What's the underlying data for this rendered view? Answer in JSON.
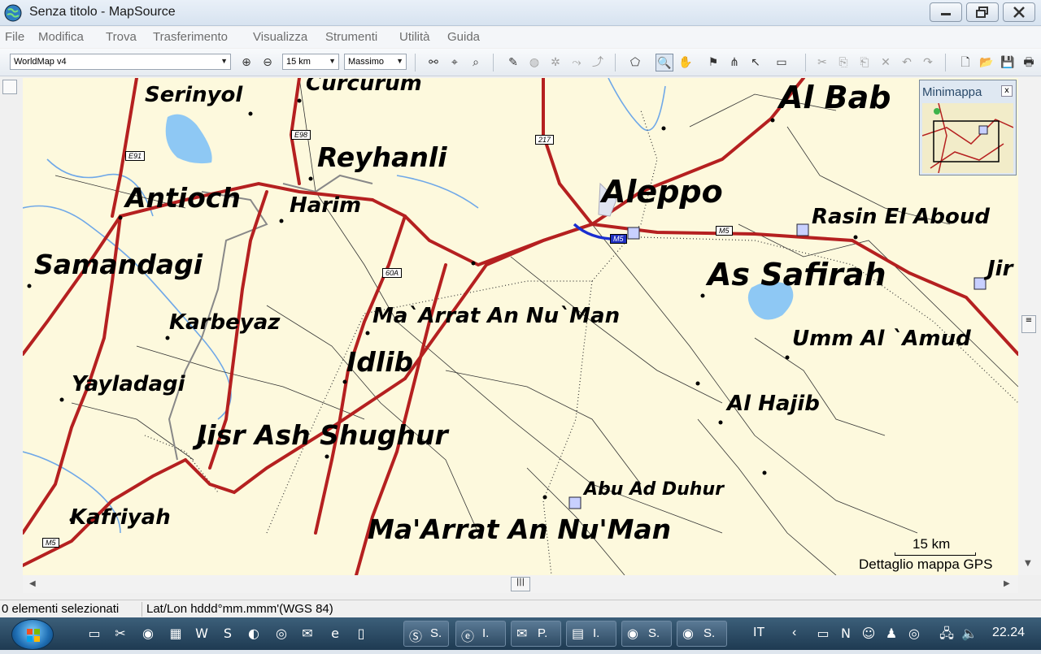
{
  "window": {
    "title": "Senza titolo - MapSource",
    "min_label": "—",
    "max_label": "❐",
    "close_label": "✕"
  },
  "menu": [
    "File",
    "Modifica",
    "Trova",
    "Trasferimento",
    "Visualizza",
    "Strumenti",
    "Utilità",
    "Guida"
  ],
  "toolbar": {
    "product": "WorldMap v4",
    "zoom_scale": "15 km",
    "detail": "Massimo"
  },
  "minimap": {
    "title": "Minimappa",
    "close": "x"
  },
  "map": {
    "places": [
      {
        "name": "Serinyol"
      },
      {
        "name": "Curcurum"
      },
      {
        "name": "Reyhanli"
      },
      {
        "name": "Antioch"
      },
      {
        "name": "Harim"
      },
      {
        "name": "Samandagi"
      },
      {
        "name": "Karbeyaz"
      },
      {
        "name": "Yayladagi"
      },
      {
        "name": "Jisr Ash Shughur"
      },
      {
        "name": "Kafriyah"
      },
      {
        "name": "Idlib"
      },
      {
        "name": "Ma`Arrat An Nu`Man"
      },
      {
        "name": "Aleppo"
      },
      {
        "name": "Al Bab"
      },
      {
        "name": "Rasin El Aboud"
      },
      {
        "name": "As Safirah"
      },
      {
        "name": "Umm Al `Amud"
      },
      {
        "name": "Al Hajib"
      },
      {
        "name": "Abu Ad Duhur"
      },
      {
        "name": "Ma'Arrat An Nu'Man"
      },
      {
        "name": "Jir"
      }
    ],
    "shields": [
      "E91",
      "E98",
      "217",
      "60A",
      "M5",
      "M5",
      "M5"
    ],
    "scale_label": "15 km",
    "detail_label": "Dettaglio mappa GPS"
  },
  "status": {
    "selected": "0 elementi selezionati",
    "coords": "Lat/Lon hddd°mm.mmm'(WGS 84)"
  },
  "taskbar": {
    "tasks": [
      {
        "label": "S.",
        "icon": "skype-icon"
      },
      {
        "label": "I.",
        "icon": "ie-icon"
      },
      {
        "label": "P.",
        "icon": "mail-icon"
      },
      {
        "label": "I.",
        "icon": "window-icon"
      },
      {
        "label": "S.",
        "icon": "mapsource-icon"
      },
      {
        "label": "S.",
        "icon": "mapsource-icon"
      }
    ],
    "lang": "IT",
    "clock": "22.24"
  },
  "colors": {
    "map_bg": "#fdf9dd",
    "road": "#b52020",
    "water": "#8ec8f4",
    "river": "#6fa8e8"
  }
}
